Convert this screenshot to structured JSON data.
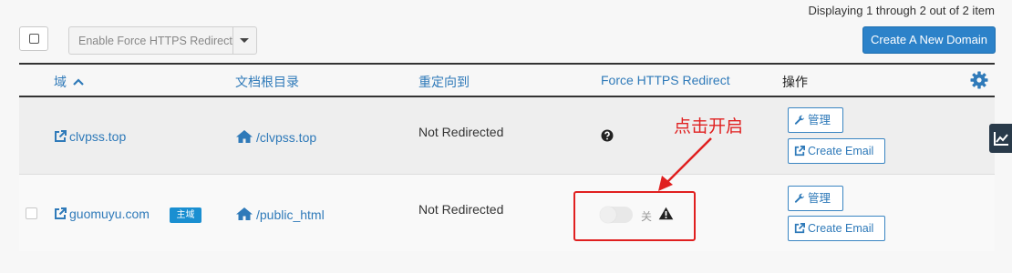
{
  "pagination": {
    "text": "Displaying 1 through 2 out of 2 item"
  },
  "toolbar": {
    "action_select_value": "Enable Force HTTPS Redirect",
    "create_button": "Create A New Domain"
  },
  "table": {
    "headers": {
      "domain": "域",
      "docroot": "文档根目录",
      "redirect": "重定向到",
      "force_https": "Force HTTPS Redirect",
      "actions": "操作"
    },
    "rows": [
      {
        "domain": "clvpss.top",
        "docroot": "/clvpss.top",
        "redirect": "Not Redirected",
        "manage": "管理",
        "create_email": "Create Email"
      },
      {
        "domain": "guomuyu.com",
        "badge": "主域",
        "docroot": "/public_html",
        "redirect": "Not Redirected",
        "toggle_state": "关",
        "toggle_on": false,
        "manage": "管理",
        "create_email": "Create Email"
      }
    ]
  },
  "annotation": {
    "text": "点击开启",
    "color": "#e02020"
  },
  "colors": {
    "accent": "#2c82c9",
    "link": "#2f7ab9",
    "badge": "#1a8fd1"
  },
  "icons": [
    "sort-up-icon",
    "gear-icon",
    "external-link-icon",
    "home-icon",
    "question-circle-icon",
    "wrench-icon",
    "warning-icon",
    "chart-icon"
  ]
}
